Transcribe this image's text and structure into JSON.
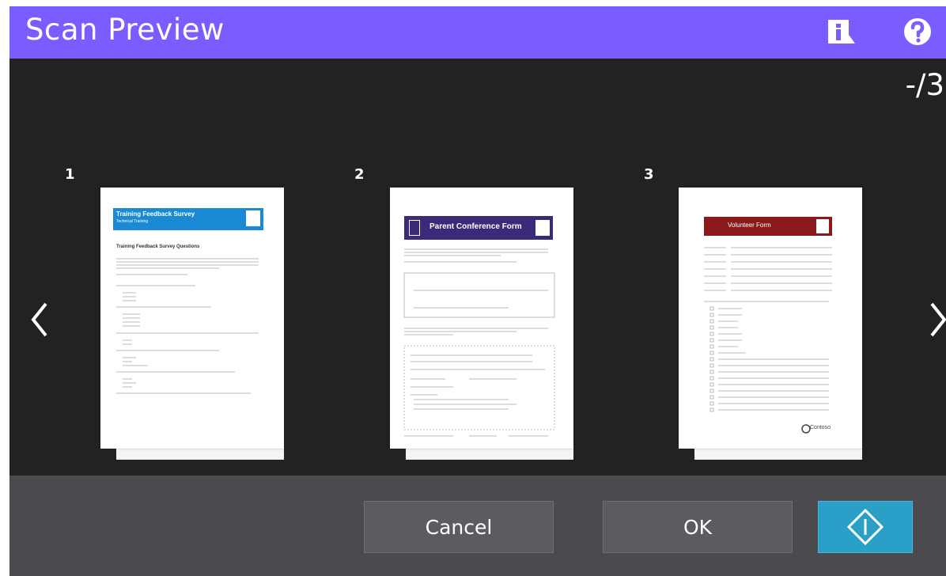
{
  "header": {
    "title": "Scan Preview",
    "info_icon": "info-icon",
    "help_icon": "help-icon",
    "color": "#7b5cff"
  },
  "preview": {
    "counter": "-/3",
    "prev_icon": "chevron-left-icon",
    "next_icon": "chevron-right-icon",
    "pages": [
      {
        "number": "1",
        "banner_title": "Training Feedback Survey",
        "banner_subtitle": "Technical Training",
        "heading": "Training Feedback Survey Questions",
        "banner_color": "#1a8ad4"
      },
      {
        "number": "2",
        "banner_title": "Parent Conference Form",
        "banner_color": "#3b2a7a"
      },
      {
        "number": "3",
        "banner_title": "Volunteer Form",
        "banner_color": "#8a1a1a",
        "logo": "Contoso"
      }
    ]
  },
  "footer": {
    "cancel_label": "Cancel",
    "ok_label": "OK",
    "start_icon": "start-icon",
    "start_color": "#2aa0c8"
  }
}
